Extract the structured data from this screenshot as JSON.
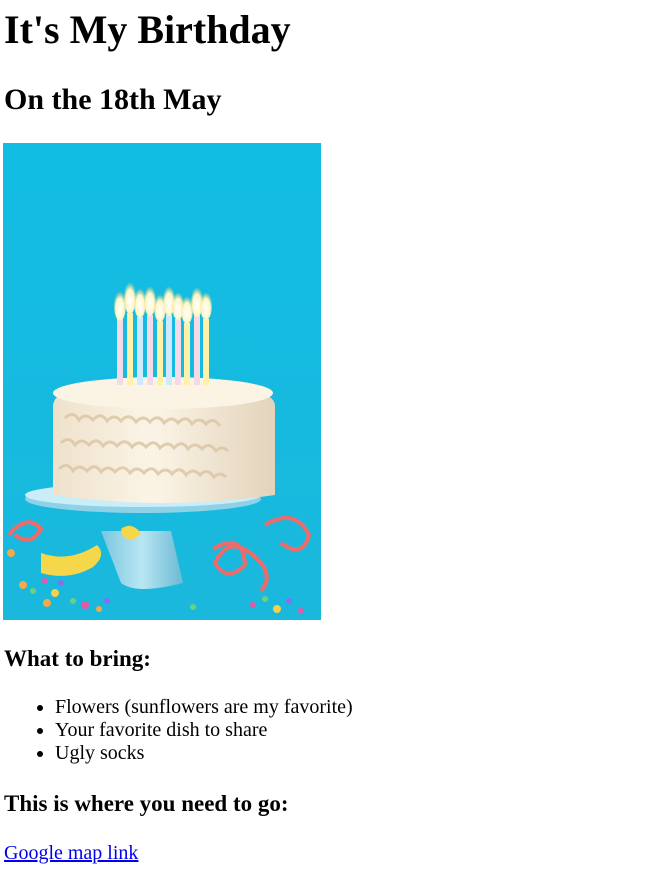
{
  "header": {
    "title": "It's My Birthday",
    "date_line": "On the 18th May"
  },
  "image": {
    "subject": "birthday cake with lit candles on a blue background"
  },
  "bring": {
    "heading": "What to bring:",
    "items": [
      "Flowers (sunflowers are my favorite)",
      "Your favorite dish to share",
      "Ugly socks"
    ]
  },
  "location": {
    "heading": "This is where you need to go:",
    "link_label": "Google map link"
  },
  "colors": {
    "background": "#ffffff",
    "text": "#000000",
    "link": "#0000ee",
    "photo_backdrop": "#16bde0"
  }
}
